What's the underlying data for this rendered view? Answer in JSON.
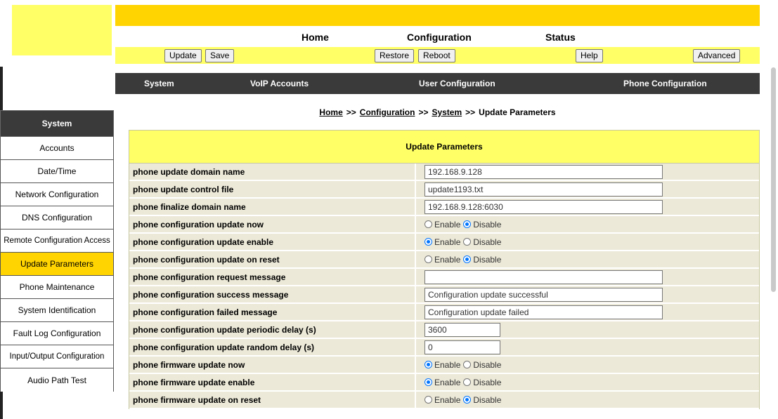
{
  "mainnav": {
    "home": "Home",
    "configuration": "Configuration",
    "status": "Status"
  },
  "buttons": {
    "update": "Update",
    "save": "Save",
    "restore": "Restore",
    "reboot": "Reboot",
    "help": "Help",
    "advanced": "Advanced"
  },
  "subnav": {
    "system": "System",
    "voip": "VoIP Accounts",
    "user": "User Configuration",
    "phone": "Phone Configuration"
  },
  "breadcrumb": {
    "home": "Home",
    "configuration": "Configuration",
    "system": "System",
    "current": "Update Parameters",
    "sep": ">>"
  },
  "sidebar": {
    "header": "System",
    "items": [
      {
        "label": "Accounts"
      },
      {
        "label": "Date/Time"
      },
      {
        "label": "Network Configuration"
      },
      {
        "label": "DNS Configuration"
      },
      {
        "label": "Remote Configuration Access"
      },
      {
        "label": "Update Parameters"
      },
      {
        "label": "Phone Maintenance"
      },
      {
        "label": "System Identification"
      },
      {
        "label": "Fault Log Configuration"
      },
      {
        "label": "Input/Output Configuration"
      },
      {
        "label": "Audio Path Test"
      }
    ]
  },
  "table": {
    "title": "Update Parameters",
    "radio_enable": "Enable",
    "radio_disable": "Disable",
    "rows": [
      {
        "label": "phone update domain name",
        "value": "192.168.9.128"
      },
      {
        "label": "phone update control file",
        "value": "update1193.txt"
      },
      {
        "label": "phone finalize domain name",
        "value": "192.168.9.128:6030"
      },
      {
        "label": "phone configuration update now",
        "selected": "Disable"
      },
      {
        "label": "phone configuration update enable",
        "selected": "Enable"
      },
      {
        "label": "phone configuration update on reset",
        "selected": "Disable"
      },
      {
        "label": "phone configuration request message",
        "value": ""
      },
      {
        "label": "phone configuration success message",
        "value": "Configuration update successful"
      },
      {
        "label": "phone configuration failed message",
        "value": "Configuration update failed"
      },
      {
        "label": "phone configuration update periodic delay (s)",
        "value": "3600"
      },
      {
        "label": "phone configuration update random delay (s)",
        "value": "0"
      },
      {
        "label": "phone firmware update now",
        "selected": "Enable"
      },
      {
        "label": "phone firmware update enable",
        "selected": "Enable"
      },
      {
        "label": "phone firmware update on reset",
        "selected": "Disable"
      }
    ]
  },
  "colors": {
    "yellow": "#ffd400",
    "light_yellow": "#ffff66",
    "dark": "#3a3a3a",
    "row_bg": "#ece9d8",
    "radio_blue": "#0075ff"
  }
}
